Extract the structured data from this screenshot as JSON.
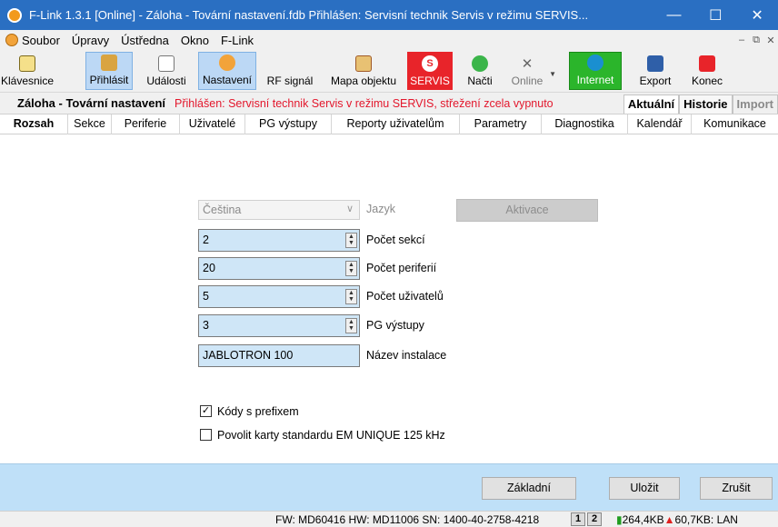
{
  "window": {
    "title": "F-Link 1.3.1 [Online] - Záloha - Tovární nastavení.fdb Přihlášen: Servisní technik Servis v režimu SERVIS...",
    "minimize": "—",
    "maximize": "☐",
    "close": "✕"
  },
  "menu": {
    "items": [
      "Soubor",
      "Úpravy",
      "Ústředna",
      "Okno",
      "F-Link"
    ],
    "mdi_controls": [
      "–",
      "⧉",
      "✕"
    ]
  },
  "toolbar": {
    "keyboard": "Klávesnice",
    "login": "Přihlásit",
    "events": "Události",
    "settings": "Nastavení",
    "rf_signal": "RF signál",
    "map": "Mapa objektu",
    "servis": "SERVIS",
    "servis_icon": "S",
    "load": "Načti",
    "online": "Online",
    "internet": "Internet",
    "export": "Export",
    "end": "Konec"
  },
  "status_strip": {
    "backup": "Záloha - Tovární nastavení",
    "logged": "Přihlášen: Servisní technik Servis v režimu SERVIS, střežení zcela vypnuto",
    "view_tabs": [
      "Aktuální",
      "Historie",
      "Import"
    ]
  },
  "tabs": [
    "Rozsah",
    "Sekce",
    "Periferie",
    "Uživatelé",
    "PG výstupy",
    "Reporty uživatelům",
    "Parametry",
    "Diagnostika",
    "Kalendář",
    "Komunikace"
  ],
  "form": {
    "language_value": "Čeština",
    "language_label": "Jazyk",
    "activation_button": "Aktivace",
    "sections_value": "2",
    "sections_label": "Počet sekcí",
    "peripherals_value": "20",
    "peripherals_label": "Počet periferií",
    "users_value": "5",
    "users_label": "Počet uživatelů",
    "pg_value": "3",
    "pg_label": "PG výstupy",
    "install_value": "JABLOTRON 100",
    "install_label": "Název instalace",
    "prefix_codes_label": "Kódy s prefixem",
    "prefix_codes_checked": true,
    "em_cards_label": "Povolit karty standardu EM UNIQUE 125 kHz",
    "em_cards_checked": false
  },
  "buttons": {
    "basic": "Základní",
    "save": "Uložit",
    "cancel": "Zrušit"
  },
  "statusbar": {
    "firmware": "FW: MD60416 HW: MD11006 SN: 1400-40-2758-4218",
    "page1": "1",
    "page2": "2",
    "down": "264,4KB",
    "up": "60,7KB: LAN"
  },
  "colors": {
    "titlebar": "#2a6fc2",
    "servis_red": "#e8242a",
    "internet_green": "#2bb52b",
    "bottom_bar": "#bfe0f8",
    "field_bg": "#cfe6f7",
    "logged_text": "#e3172c"
  }
}
